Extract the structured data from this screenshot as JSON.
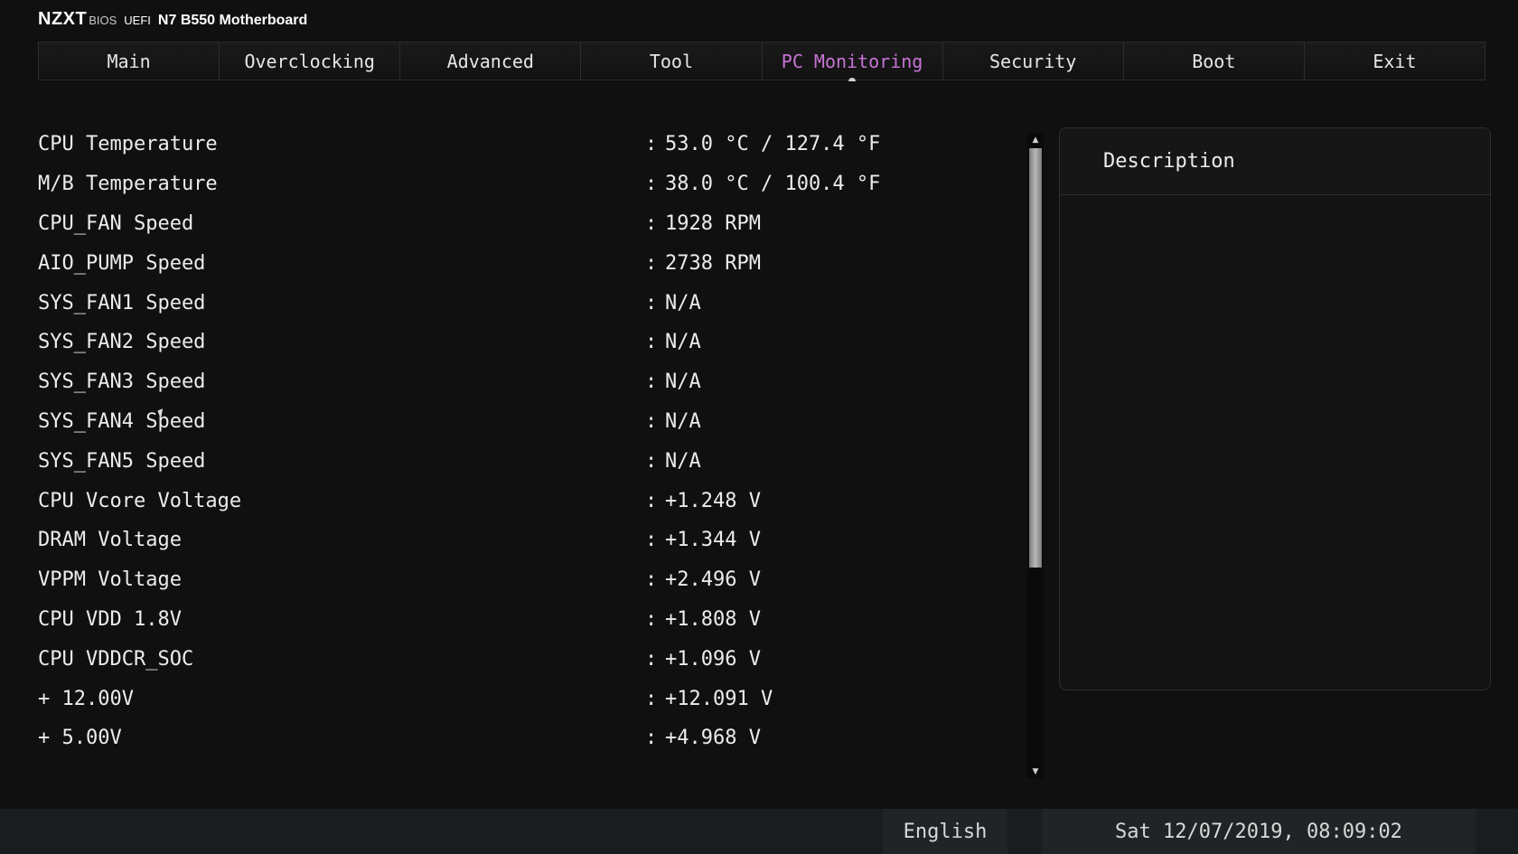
{
  "brand": {
    "logo": "NZXT",
    "bios": "BIOS",
    "uefi": "UEFI",
    "model": "N7 B550 Motherboard"
  },
  "tabs": [
    {
      "label": "Main"
    },
    {
      "label": "Overclocking"
    },
    {
      "label": "Advanced"
    },
    {
      "label": "Tool"
    },
    {
      "label": "PC Monitoring",
      "active": true
    },
    {
      "label": "Security"
    },
    {
      "label": "Boot"
    },
    {
      "label": "Exit"
    }
  ],
  "monitor": {
    "separator": ":",
    "rows": [
      {
        "label": "CPU Temperature",
        "value": "53.0 °C / 127.4 °F"
      },
      {
        "label": "M/B Temperature",
        "value": "38.0 °C / 100.4 °F"
      },
      {
        "label": "CPU_FAN Speed",
        "value": "1928 RPM"
      },
      {
        "label": "AIO_PUMP Speed",
        "value": "2738 RPM"
      },
      {
        "label": "SYS_FAN1 Speed",
        "value": "N/A"
      },
      {
        "label": "SYS_FAN2 Speed",
        "value": "N/A"
      },
      {
        "label": "SYS_FAN3 Speed",
        "value": "N/A"
      },
      {
        "label": "SYS_FAN4 Speed",
        "value": "N/A"
      },
      {
        "label": "SYS_FAN5 Speed",
        "value": "N/A"
      },
      {
        "label": "CPU Vcore Voltage",
        "value": "+1.248 V"
      },
      {
        "label": "DRAM Voltage",
        "value": "+1.344 V"
      },
      {
        "label": "VPPM Voltage",
        "value": "+2.496 V"
      },
      {
        "label": "CPU VDD 1.8V",
        "value": "+1.808 V"
      },
      {
        "label": "CPU VDDCR_SOC",
        "value": "+1.096 V"
      },
      {
        "label": "+ 12.00V",
        "value": "+12.091 V"
      },
      {
        "label": "+ 5.00V",
        "value": "+4.968 V"
      }
    ]
  },
  "scrollbar": {
    "up_icon": "arrow-up-icon",
    "down_icon": "arrow-down-icon",
    "up_glyph": "▲",
    "down_glyph": "▼"
  },
  "description": {
    "title": "Description"
  },
  "footer": {
    "language": "English",
    "datetime": "Sat 12/07/2019, 08:09:02"
  },
  "colors": {
    "active_tab": "#c873d6",
    "background": "#101010",
    "footer": "#1a1d1f"
  }
}
